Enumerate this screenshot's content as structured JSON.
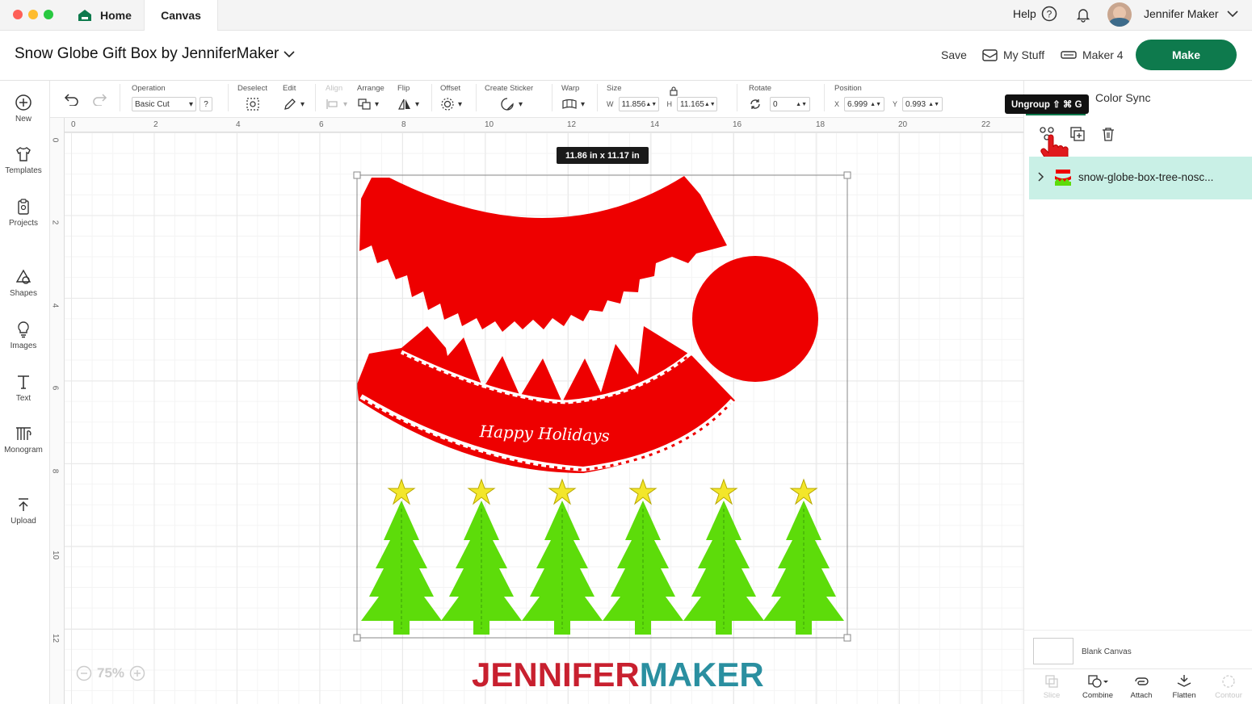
{
  "window": {
    "tabs": [
      {
        "label": "Home"
      },
      {
        "label": "Canvas"
      }
    ]
  },
  "header": {
    "help": "Help",
    "user": "Jennifer Maker"
  },
  "title_bar": {
    "project_title": "Snow Globe Gift Box by JenniferMaker",
    "save": "Save",
    "my_stuff": "My Stuff",
    "machine": "Maker 4",
    "make": "Make"
  },
  "sidebar": {
    "items": [
      {
        "label": "New",
        "icon": "plus-circle-icon"
      },
      {
        "label": "Templates",
        "icon": "shirt-icon"
      },
      {
        "label": "Projects",
        "icon": "clipboard-icon"
      },
      {
        "label": "Shapes",
        "icon": "shapes-icon"
      },
      {
        "label": "Images",
        "icon": "bulb-icon"
      },
      {
        "label": "Text",
        "icon": "text-icon"
      },
      {
        "label": "Monogram",
        "icon": "monogram-icon"
      },
      {
        "label": "Upload",
        "icon": "upload-icon"
      }
    ]
  },
  "toolbar": {
    "operation_label": "Operation",
    "operation_value": "Basic Cut",
    "operation_help": "?",
    "deselect": "Deselect",
    "edit": "Edit",
    "align": "Align",
    "arrange": "Arrange",
    "flip": "Flip",
    "offset": "Offset",
    "create_sticker": "Create Sticker",
    "warp": "Warp",
    "size_label": "Size",
    "w_label": "W",
    "w_value": "11.856",
    "h_label": "H",
    "h_value": "11.165",
    "rotate_label": "Rotate",
    "rotate_value": "0",
    "position_label": "Position",
    "x_label": "X",
    "x_value": "6.999",
    "y_label": "Y",
    "y_value": "0.993"
  },
  "rulers": {
    "top": [
      "0",
      "2",
      "4",
      "6",
      "8",
      "10",
      "12",
      "14",
      "16",
      "18",
      "20",
      "22"
    ],
    "left": [
      "0",
      "2",
      "4",
      "6",
      "8",
      "10",
      "12"
    ]
  },
  "canvas": {
    "size_badge": "11.86  in x 11.17  in",
    "wrap_text": "Happy Holidays",
    "zoom": "75%",
    "watermark_a": "JENNIFER",
    "watermark_b": "MAKER"
  },
  "layers_panel": {
    "tooltip": "Ungroup ⇧ ⌘ G",
    "color_sync": "Color Sync",
    "layer_name": "snow-globe-box-tree-nosc...",
    "blank_canvas": "Blank Canvas"
  },
  "bottom_actions": [
    {
      "label": "Slice",
      "enabled": false
    },
    {
      "label": "Combine",
      "enabled": true
    },
    {
      "label": "Attach",
      "enabled": true
    },
    {
      "label": "Flatten",
      "enabled": true
    },
    {
      "label": "Contour",
      "enabled": false
    }
  ],
  "colors": {
    "accent": "#0e7a4d",
    "red": "#ee0000",
    "green": "#5ddc0a",
    "star": "#f3e62a",
    "layer_selected": "#c9f0e6"
  }
}
